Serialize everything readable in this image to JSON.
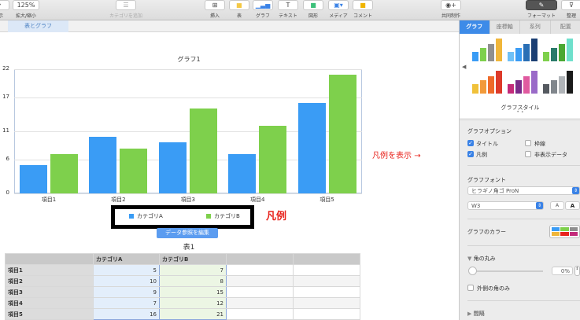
{
  "toolbar": {
    "view": "表示",
    "zoom_value": "125%",
    "zoom": "拡大/縮小",
    "add_category": "カテゴリを追加",
    "insert": "挿入",
    "table": "表",
    "chart": "グラフ",
    "text": "テキスト",
    "shape": "図形",
    "media": "メディア",
    "comment": "コメント",
    "collaborate": "共同制作",
    "format": "フォーマット",
    "organize": "整理"
  },
  "sheet_tab": "表とグラフ",
  "panel": {
    "tabs": [
      "グラフ",
      "座標軸",
      "系列",
      "配置"
    ],
    "style_label": "グラフスタイル",
    "options_title": "グラフオプション",
    "opt_title": "タイトル",
    "opt_legend": "凡例",
    "opt_border": "枠線",
    "opt_hidden": "非表示データ",
    "font_title": "グラフフォント",
    "font_name": "ヒラギノ角ゴ ProN",
    "font_weight": "W3",
    "font_small": "A",
    "font_large": "A",
    "colors_label": "グラフのカラー",
    "corner_title": "角の丸み",
    "corner_value": "0%",
    "outer_only": "外側の角のみ",
    "spacing": "間隔",
    "styles": [
      [
        "#3a9cf5",
        "#7ed04c",
        "#8f8f8f",
        "#f0b63a"
      ],
      [
        "#6ec0f7",
        "#3a9cf5",
        "#2a6fb5",
        "#1b3f73"
      ],
      [
        "#7ed04c",
        "#2a7a6a",
        "#4aa832",
        "#6fe0cc"
      ],
      [
        "#f0c13a",
        "#f29a3a",
        "#ee6a2a",
        "#dd3a2a"
      ],
      [
        "#c32a7a",
        "#7a2a8a",
        "#e05aa0",
        "#9a6ac8"
      ],
      [
        "#555a60",
        "#80868c",
        "#b0b4b8",
        "#1a1a1a"
      ]
    ]
  },
  "chart_data": {
    "type": "bar",
    "title": "グラフ1",
    "categories": [
      "項目1",
      "項目2",
      "項目3",
      "項目4",
      "項目5"
    ],
    "series": [
      {
        "name": "カテゴリA",
        "values": [
          5,
          10,
          9,
          7,
          16
        ],
        "color": "#3a9cf5"
      },
      {
        "name": "カテゴリB",
        "values": [
          7,
          8,
          15,
          12,
          21
        ],
        "color": "#7ed04c"
      }
    ],
    "yticks": [
      "0",
      "6",
      "11",
      "17",
      "22"
    ],
    "ylim": [
      0,
      22
    ],
    "legend": "bottom"
  },
  "edit_data_button": "データ参照を編集",
  "annotations": {
    "legend_label": "凡例",
    "show_legend": "凡例を表示"
  },
  "table": {
    "title": "表1",
    "headers": [
      "",
      "カテゴリA",
      "カテゴリB",
      "",
      ""
    ],
    "rows": [
      [
        "項目1",
        "5",
        "7"
      ],
      [
        "項目2",
        "10",
        "8"
      ],
      [
        "項目3",
        "9",
        "15"
      ],
      [
        "項目4",
        "7",
        "12"
      ],
      [
        "項目5",
        "16",
        "21"
      ]
    ]
  }
}
